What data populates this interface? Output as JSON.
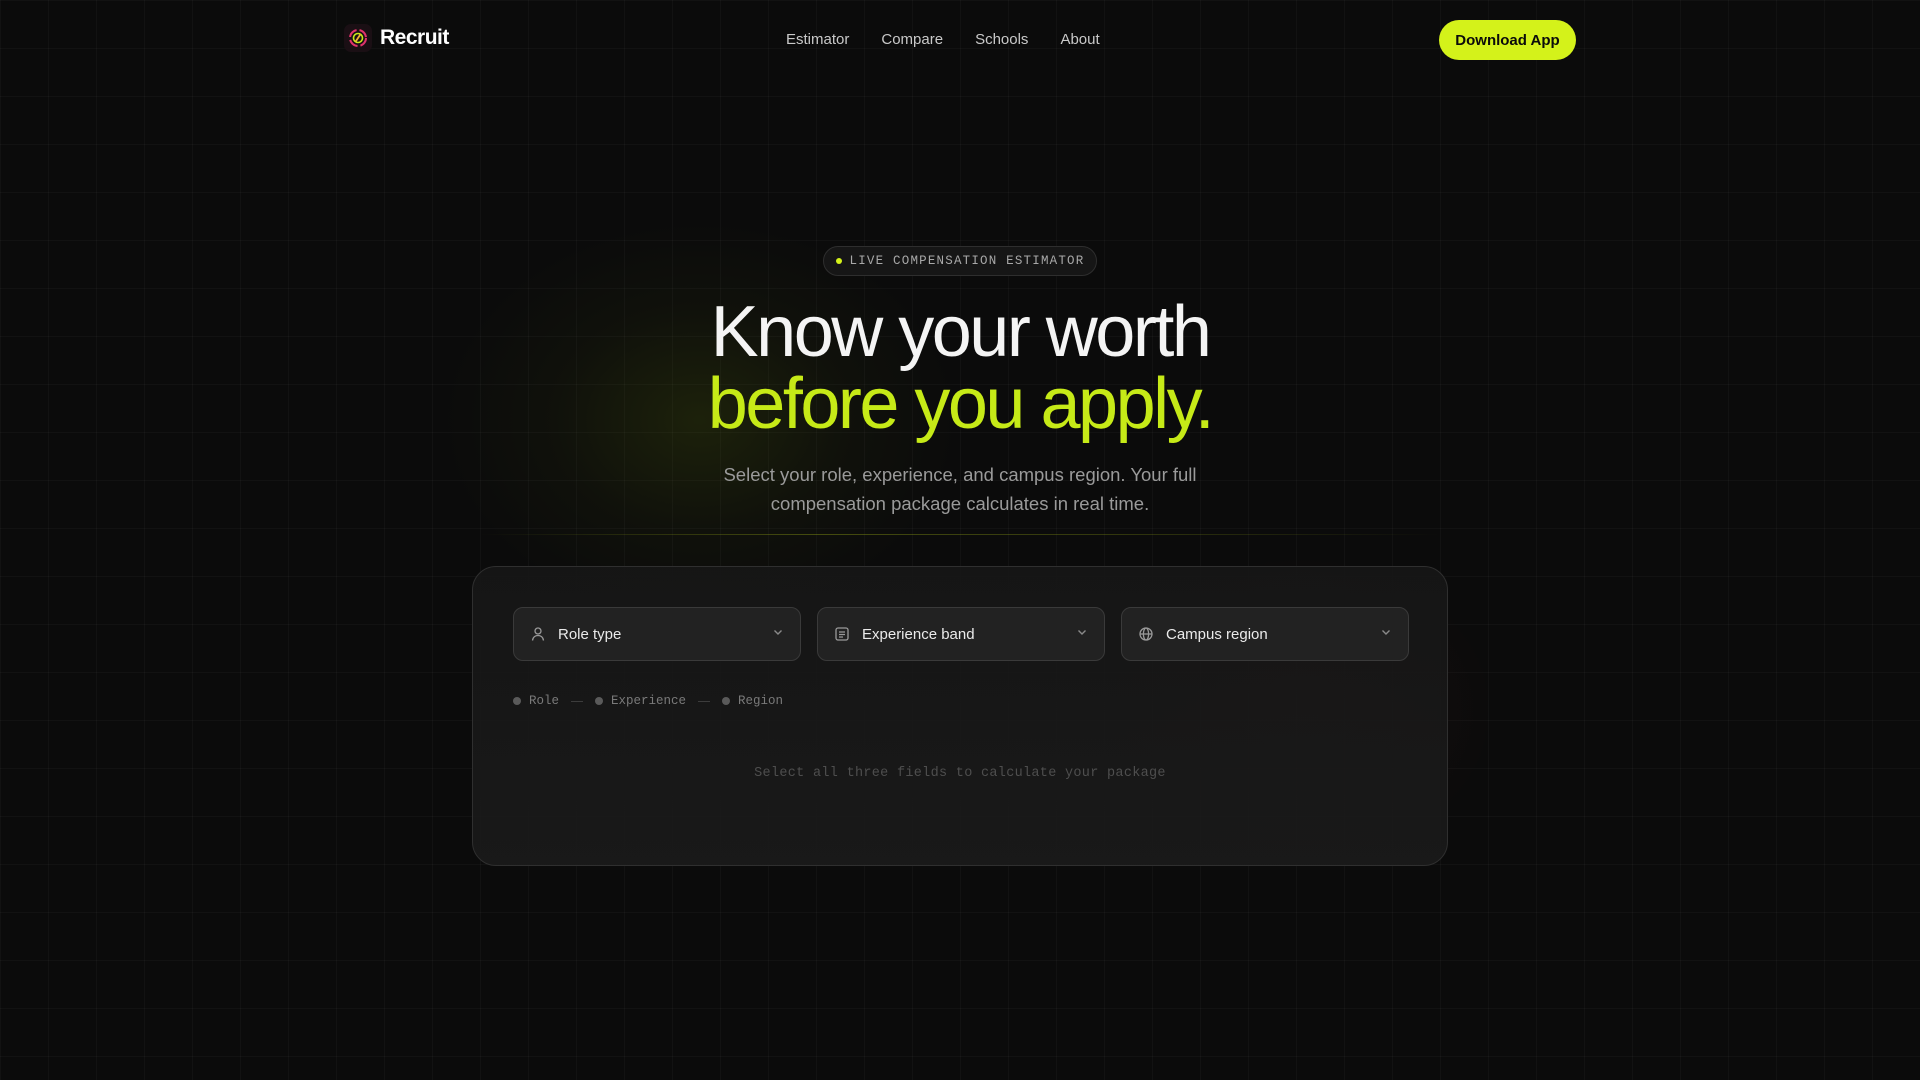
{
  "brand": {
    "name": "Recruit",
    "logo_icon": "brand-logo-icon"
  },
  "nav": {
    "links": [
      "Estimator",
      "Compare",
      "Schools",
      "About"
    ],
    "cta_label": "Download App"
  },
  "hero": {
    "badge": "LIVE COMPENSATION ESTIMATOR",
    "headline_line1": "Know your worth",
    "headline_line2": "before you apply.",
    "subtitle": "Select your role, experience, and campus region. Your full compensation package calculates in real time."
  },
  "estimator": {
    "selects": [
      {
        "label": "Role type",
        "icon": "user-icon"
      },
      {
        "label": "Experience band",
        "icon": "list-icon"
      },
      {
        "label": "Campus region",
        "icon": "globe-icon"
      }
    ],
    "steps": [
      "Role",
      "Experience",
      "Region"
    ],
    "hint": "Select all three fields to calculate your package"
  },
  "colors": {
    "accent": "#d4f21a",
    "accent_text": "#c6ea17",
    "background": "#0b0b0b"
  }
}
